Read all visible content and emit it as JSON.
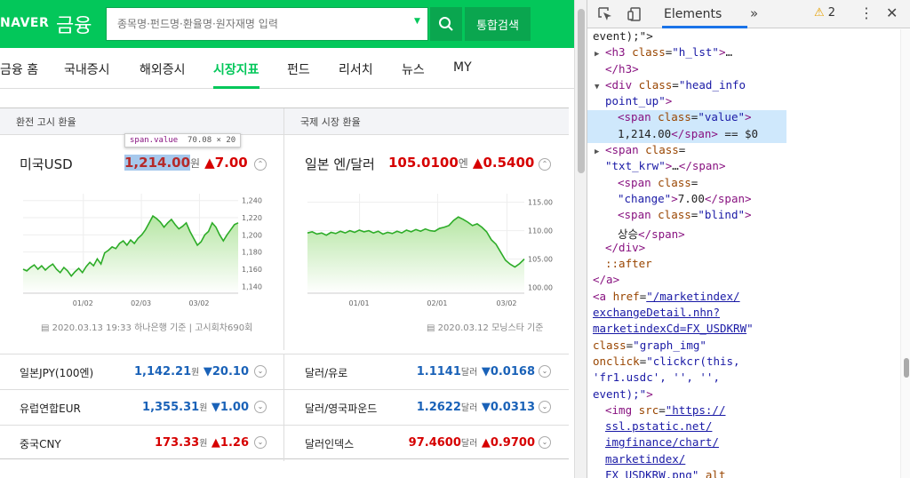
{
  "header": {
    "logo": "NAVER",
    "logo_sub": "금융",
    "search_placeholder": "종목명·펀드명·환율명·원자재명 입력",
    "search_button_label": "통합검색"
  },
  "nav": {
    "items": [
      "금융 홈",
      "국내증시",
      "해외증시",
      "시장지표",
      "펀드",
      "리서치",
      "뉴스",
      "MY"
    ],
    "active": "시장지표"
  },
  "exchange": {
    "section_title": "환전 고시 환율",
    "name": "미국USD",
    "value": "1,214.00",
    "unit": "원",
    "change": "▲7.00",
    "source": "2020.03.13 19:33 하나은행 기준",
    "notice": "고시회차690회",
    "tooltip_tag": "span.value",
    "tooltip_size": "70.08 × 20"
  },
  "international": {
    "section_title": "국제 시장 환율",
    "name": "일본 엔/달러",
    "value": "105.0100",
    "unit": "엔",
    "change": "▲0.5400",
    "source": "2020.03.12 모닝스타 기준"
  },
  "chart_data": [
    {
      "type": "area",
      "title": "",
      "x_ticks": [
        "01/02",
        "02/03",
        "03/02"
      ],
      "y_ticks": [
        1140,
        1160,
        1180,
        1200,
        1220,
        1240
      ],
      "ylim": [
        1132,
        1248
      ],
      "grid": true,
      "color": "#2dac28",
      "series": [
        {
          "values": [
            1160,
            1158,
            1162,
            1165,
            1160,
            1164,
            1159,
            1163,
            1166,
            1160,
            1156,
            1162,
            1158,
            1152,
            1157,
            1161,
            1156,
            1163,
            1168,
            1164,
            1172,
            1166,
            1179,
            1182,
            1186,
            1184,
            1190,
            1193,
            1188,
            1194,
            1190,
            1196,
            1200,
            1206,
            1214,
            1222,
            1219,
            1215,
            1209,
            1214,
            1218,
            1212,
            1207,
            1210,
            1214,
            1204,
            1196,
            1188,
            1192,
            1200,
            1204,
            1214,
            1209,
            1200,
            1193,
            1200,
            1206,
            1212,
            1214
          ]
        }
      ]
    },
    {
      "type": "area",
      "title": "",
      "x_ticks": [
        "01/01",
        "02/01",
        "03/02"
      ],
      "y_ticks": [
        100,
        105,
        110,
        115
      ],
      "ylim": [
        99,
        116.5
      ],
      "grid": true,
      "color": "#2dac28",
      "series": [
        {
          "values": [
            109.6,
            109.8,
            109.4,
            109.6,
            109.2,
            109.7,
            109.5,
            109.9,
            109.6,
            110.0,
            109.7,
            110.1,
            109.8,
            110.0,
            109.6,
            109.9,
            109.4,
            109.7,
            109.5,
            109.9,
            109.6,
            110.1,
            109.8,
            110.2,
            109.9,
            110.3,
            110.0,
            109.9,
            110.4,
            110.6,
            110.9,
            111.8,
            112.4,
            112.0,
            111.5,
            110.9,
            111.2,
            110.6,
            109.8,
            108.4,
            107.6,
            106.2,
            104.8,
            104.1,
            103.6,
            104.2,
            105.0
          ]
        }
      ]
    }
  ],
  "rows": [
    {
      "left_name": "일본JPY(100엔)",
      "left_value": "1,142.21",
      "left_unit": "원",
      "left_change": "▼20.10",
      "left_dir": "down",
      "right_name": "달러/유로",
      "right_value": "1.1141",
      "right_unit": "달러",
      "right_change": "▼0.0168",
      "right_dir": "down"
    },
    {
      "left_name": "유럽연합EUR",
      "left_value": "1,355.31",
      "left_unit": "원",
      "left_change": "▼1.00",
      "left_dir": "down",
      "right_name": "달러/영국파운드",
      "right_value": "1.2622",
      "right_unit": "달러",
      "right_change": "▼0.0313",
      "right_dir": "down"
    },
    {
      "left_name": "중국CNY",
      "left_value": "173.33",
      "left_unit": "원",
      "left_change": "▲1.26",
      "left_dir": "up",
      "right_name": "달러인덱스",
      "right_value": "97.4600",
      "right_unit": "달러",
      "right_change": "▲0.9700",
      "right_dir": "up"
    }
  ],
  "devtools": {
    "tab": "Elements",
    "more": "»",
    "warnings": "2"
  },
  "dom_lines": [
    {
      "i": 0,
      "t": [
        [
          "",
          "event);\">"
        ]
      ]
    },
    {
      "i": 1,
      "tri": "▶",
      "t": [
        [
          "tag",
          "<h3 "
        ],
        [
          "attr",
          "class"
        ],
        [
          "",
          "="
        ],
        [
          "aval",
          "\"h_lst\""
        ],
        [
          "tag",
          ">"
        ],
        [
          "",
          "…"
        ]
      ]
    },
    {
      "i": 1,
      "t": [
        [
          "tag",
          "</h3>"
        ]
      ]
    },
    {
      "i": 1,
      "tri": "▼",
      "t": [
        [
          "tag",
          "<div "
        ],
        [
          "attr",
          "class"
        ],
        [
          "",
          "="
        ],
        [
          "aval",
          "\"head_info"
        ]
      ]
    },
    {
      "i": 1,
      "t": [
        [
          "aval",
          "point_up\""
        ],
        [
          "tag",
          ">"
        ]
      ]
    },
    {
      "i": 2,
      "sel": true,
      "t": [
        [
          "tag",
          "<span "
        ],
        [
          "attr",
          "class"
        ],
        [
          "",
          "="
        ],
        [
          "aval",
          "\"value\""
        ],
        [
          "tag",
          ">"
        ]
      ]
    },
    {
      "i": 2,
      "sel": true,
      "t": [
        [
          "",
          "1,214.00"
        ],
        [
          "tag",
          "</span>"
        ],
        [
          "",
          " == $0"
        ]
      ]
    },
    {
      "i": 1,
      "tri": "▶",
      "t": [
        [
          "tag",
          "<span "
        ],
        [
          "attr",
          "class"
        ],
        [
          "",
          "="
        ]
      ]
    },
    {
      "i": 1,
      "t": [
        [
          "aval",
          "\"txt_krw\""
        ],
        [
          "tag",
          ">"
        ],
        [
          "",
          "…"
        ],
        [
          "tag",
          "</span>"
        ]
      ]
    },
    {
      "i": 2,
      "t": [
        [
          "tag",
          "<span "
        ],
        [
          "attr",
          "class"
        ],
        [
          "",
          "="
        ]
      ]
    },
    {
      "i": 2,
      "t": [
        [
          "aval",
          "\"change\""
        ],
        [
          "tag",
          ">"
        ],
        [
          "",
          "7.00"
        ],
        [
          "tag",
          "</span>"
        ]
      ]
    },
    {
      "i": 2,
      "t": [
        [
          "tag",
          "<span "
        ],
        [
          "attr",
          "class"
        ],
        [
          "",
          "="
        ],
        [
          "aval",
          "\"blind\""
        ],
        [
          "tag",
          ">"
        ]
      ]
    },
    {
      "i": 2,
      "t": [
        [
          "",
          "상승"
        ],
        [
          "tag",
          "</span>"
        ]
      ]
    },
    {
      "i": 1,
      "t": [
        [
          "tag",
          "</div>"
        ]
      ]
    },
    {
      "i": 1,
      "t": [
        [
          "attr",
          "::after"
        ]
      ]
    },
    {
      "i": 0,
      "t": [
        [
          "tag",
          "</a>"
        ]
      ]
    },
    {
      "i": 0,
      "tri": "▼",
      "t": [
        [
          "tag",
          "<a "
        ],
        [
          "attr",
          "href"
        ],
        [
          "",
          "="
        ],
        [
          "link",
          "\"/marketindex/"
        ]
      ]
    },
    {
      "i": 0,
      "t": [
        [
          "link",
          "exchangeDetail.nhn?"
        ]
      ]
    },
    {
      "i": 0,
      "t": [
        [
          "link",
          "marketindexCd=FX_USDKRW"
        ],
        [
          "aval",
          "\""
        ]
      ]
    },
    {
      "i": 0,
      "t": [
        [
          "attr",
          "class"
        ],
        [
          "",
          "="
        ],
        [
          "aval",
          "\"graph_img\""
        ]
      ]
    },
    {
      "i": 0,
      "t": [
        [
          "attr",
          "onclick"
        ],
        [
          "",
          "="
        ],
        [
          "aval",
          "\"clickcr(this,"
        ]
      ]
    },
    {
      "i": 0,
      "t": [
        [
          "aval",
          "'fr1.usdc', '', '',"
        ]
      ]
    },
    {
      "i": 0,
      "t": [
        [
          "aval",
          "event);\""
        ],
        [
          "tag",
          ">"
        ]
      ]
    },
    {
      "i": 1,
      "t": [
        [
          "tag",
          "<img "
        ],
        [
          "attr",
          "src"
        ],
        [
          "",
          "="
        ],
        [
          "link",
          "\"https://"
        ]
      ]
    },
    {
      "i": 1,
      "t": [
        [
          "link",
          "ssl.pstatic.net/"
        ]
      ]
    },
    {
      "i": 1,
      "t": [
        [
          "link",
          "imgfinance/chart/"
        ]
      ]
    },
    {
      "i": 1,
      "t": [
        [
          "link",
          "marketindex/"
        ]
      ]
    },
    {
      "i": 1,
      "t": [
        [
          "link",
          "FX_USDKRW.png\""
        ],
        [
          "",
          " "
        ],
        [
          "attr",
          "alt"
        ]
      ]
    }
  ]
}
